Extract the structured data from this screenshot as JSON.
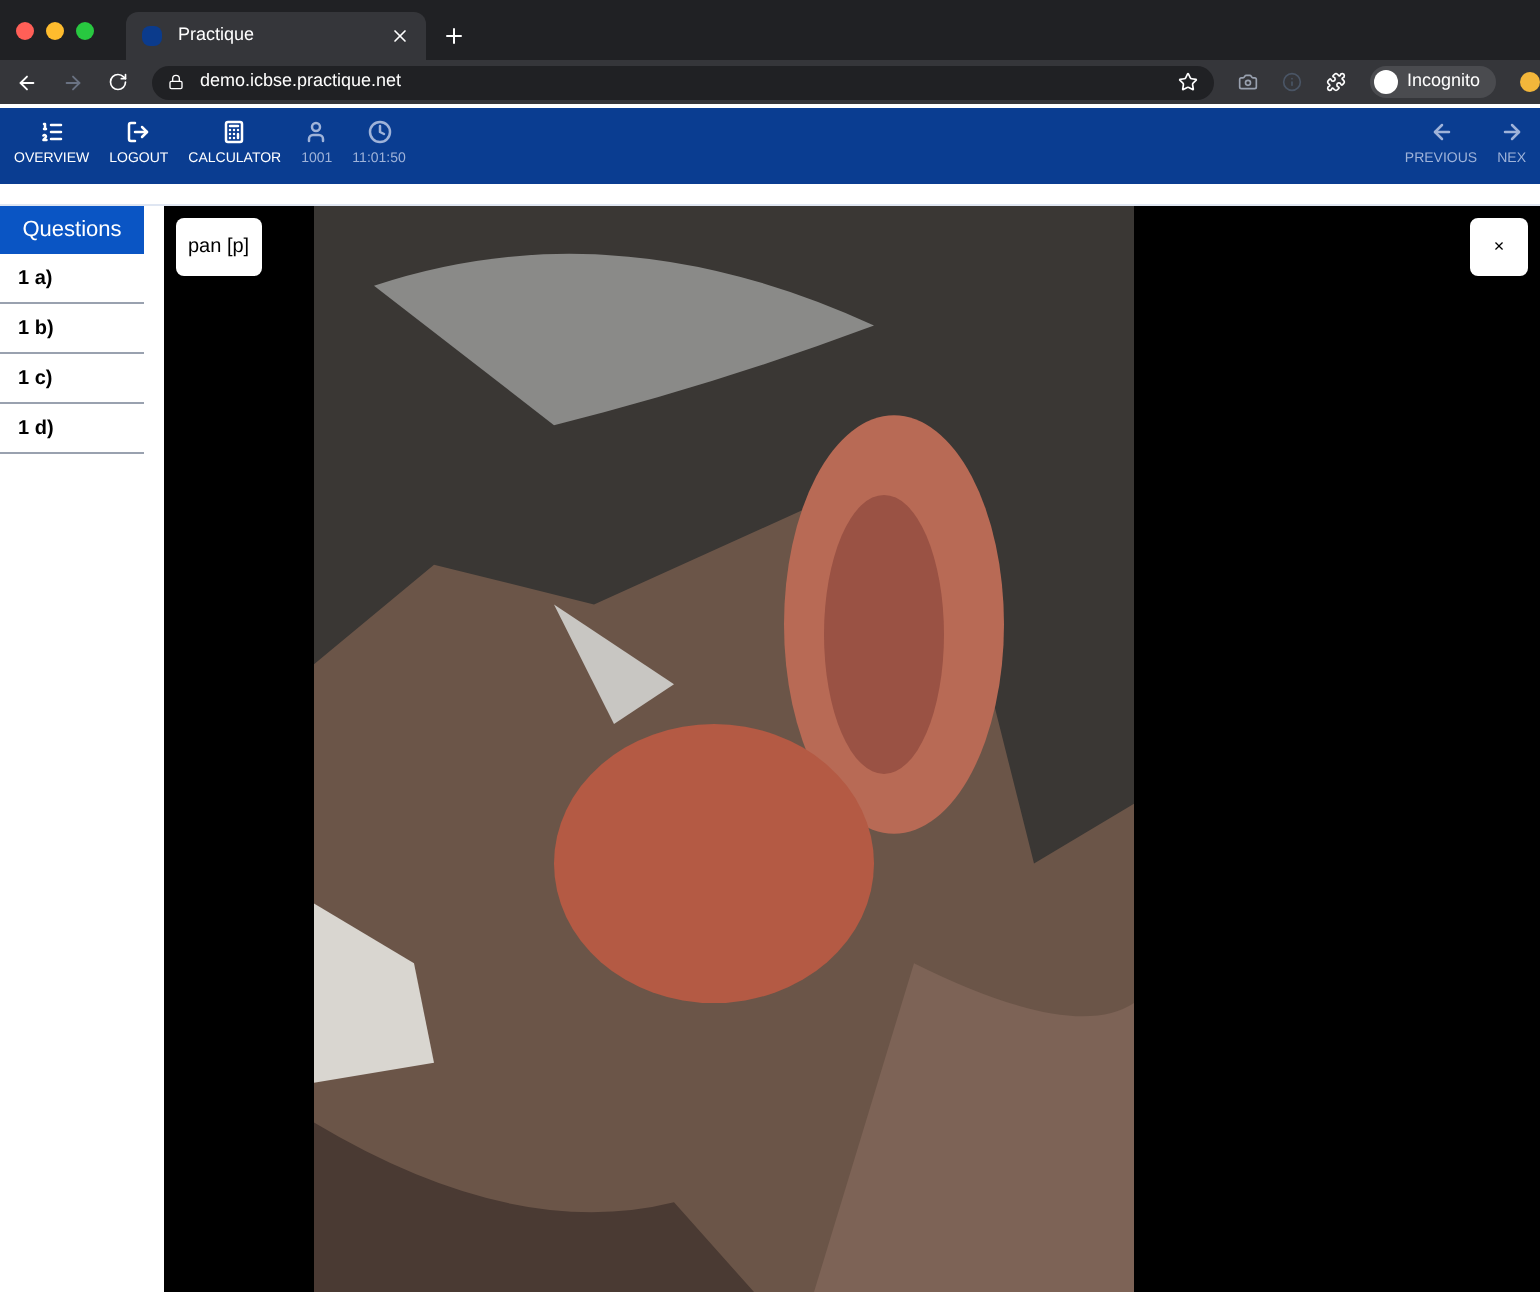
{
  "browser": {
    "tab": {
      "title": "Practique"
    },
    "url": "demo.icbse.practique.net",
    "profile": "Incognito"
  },
  "toolbar": {
    "left": [
      {
        "kind": "list",
        "label": "OVERVIEW",
        "disabled": false
      },
      {
        "kind": "logout",
        "label": "LOGOUT",
        "disabled": false
      },
      {
        "kind": "calculator",
        "label": "CALCULATOR",
        "disabled": false
      },
      {
        "kind": "user",
        "label": "1001",
        "disabled": true
      },
      {
        "kind": "clock",
        "label": "11:01:50",
        "disabled": true
      }
    ],
    "right": [
      {
        "kind": "previous",
        "label": "PREVIOUS",
        "disabled": true
      },
      {
        "kind": "next",
        "label": "NEX",
        "disabled": true
      }
    ]
  },
  "sidebar": {
    "header": "Questions",
    "items": [
      {
        "label": "1 a)"
      },
      {
        "label": "1 b)"
      },
      {
        "label": "1 c)"
      },
      {
        "label": "1 d)"
      }
    ]
  },
  "viewer": {
    "mode_button": "pan [p]",
    "close_button": "×"
  }
}
